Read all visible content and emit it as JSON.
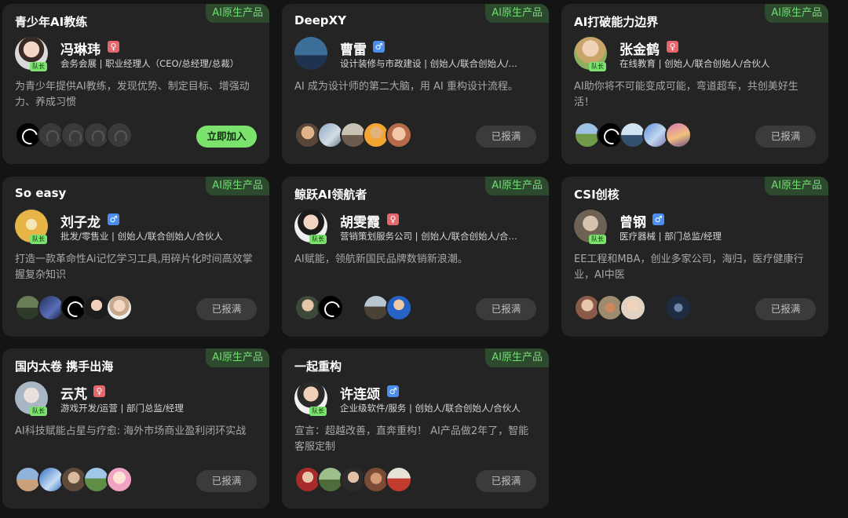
{
  "badge_label": "AI原生产品",
  "captain_label": "队长",
  "cards": [
    {
      "title": "青少年AI教练",
      "leader": {
        "name": "冯琳玮",
        "gender": "female",
        "gender_icon": "female-icon",
        "meta": "会务会展 | 职业经理人（CEO/总经理/总裁）"
      },
      "description": "为青少年提供AI教练，发现优势、制定目标、增强动力、养成习惯",
      "button": {
        "label": "立即加入",
        "state": "join"
      }
    },
    {
      "title": "DeepXY",
      "leader": {
        "name": "曹雷",
        "gender": "male",
        "gender_icon": "male-icon",
        "meta": "设计装修与市政建设 | 创始人/联合创始人/…"
      },
      "description": "AI 成为设计师的第二大脑，用 AI 重构设计流程。",
      "button": {
        "label": "已报满",
        "state": "full"
      }
    },
    {
      "title": "AI打破能力边界",
      "leader": {
        "name": "张金鹤",
        "gender": "female",
        "gender_icon": "female-icon",
        "meta": "在线教育 | 创始人/联合创始人/合伙人"
      },
      "description": "AI助你将不可能变成可能，弯道超车，共创美好生活！",
      "button": {
        "label": "已报满",
        "state": "full"
      }
    },
    {
      "title": "So easy",
      "leader": {
        "name": "刘子龙",
        "gender": "male",
        "gender_icon": "male-icon",
        "meta": "批发/零售业 | 创始人/联合创始人/合伙人"
      },
      "description": "打造一款革命性Ai记忆学习工具,用碎片化时间高效掌握复杂知识",
      "button": {
        "label": "已报满",
        "state": "full"
      }
    },
    {
      "title": "鲸跃AI领航者",
      "leader": {
        "name": "胡雯霞",
        "gender": "female",
        "gender_icon": "female-icon",
        "meta": "营销策划服务公司 | 创始人/联合创始人/合…"
      },
      "description": "AI赋能，领航新国民品牌数销新浪潮。",
      "button": {
        "label": "已报满",
        "state": "full"
      }
    },
    {
      "title": "CSI创核",
      "leader": {
        "name": "曾钢",
        "gender": "male",
        "gender_icon": "male-icon",
        "meta": "医疗器械 | 部门总监/经理"
      },
      "description": "EE工程和MBA，创业多家公司，海归，医疗健康行业，AI中医",
      "button": {
        "label": "已报满",
        "state": "full"
      }
    },
    {
      "title": "国内太卷 携手出海",
      "leader": {
        "name": "云芃",
        "gender": "female",
        "gender_icon": "female-icon",
        "meta": "游戏开发/运营 | 部门总监/经理"
      },
      "description": "AI科技赋能占星与疗愈: 海外市场商业盈利闭环实战",
      "button": {
        "label": "已报满",
        "state": "full"
      }
    },
    {
      "title": "一起重构",
      "leader": {
        "name": "许连颂",
        "gender": "male",
        "gender_icon": "male-icon",
        "meta": "企业级软件/服务 | 创始人/联合创始人/合伙人"
      },
      "description": "宣言：超越改善，直奔重构！ AI产品做2年了，智能客服定制",
      "button": {
        "label": "已报满",
        "state": "full"
      }
    }
  ]
}
